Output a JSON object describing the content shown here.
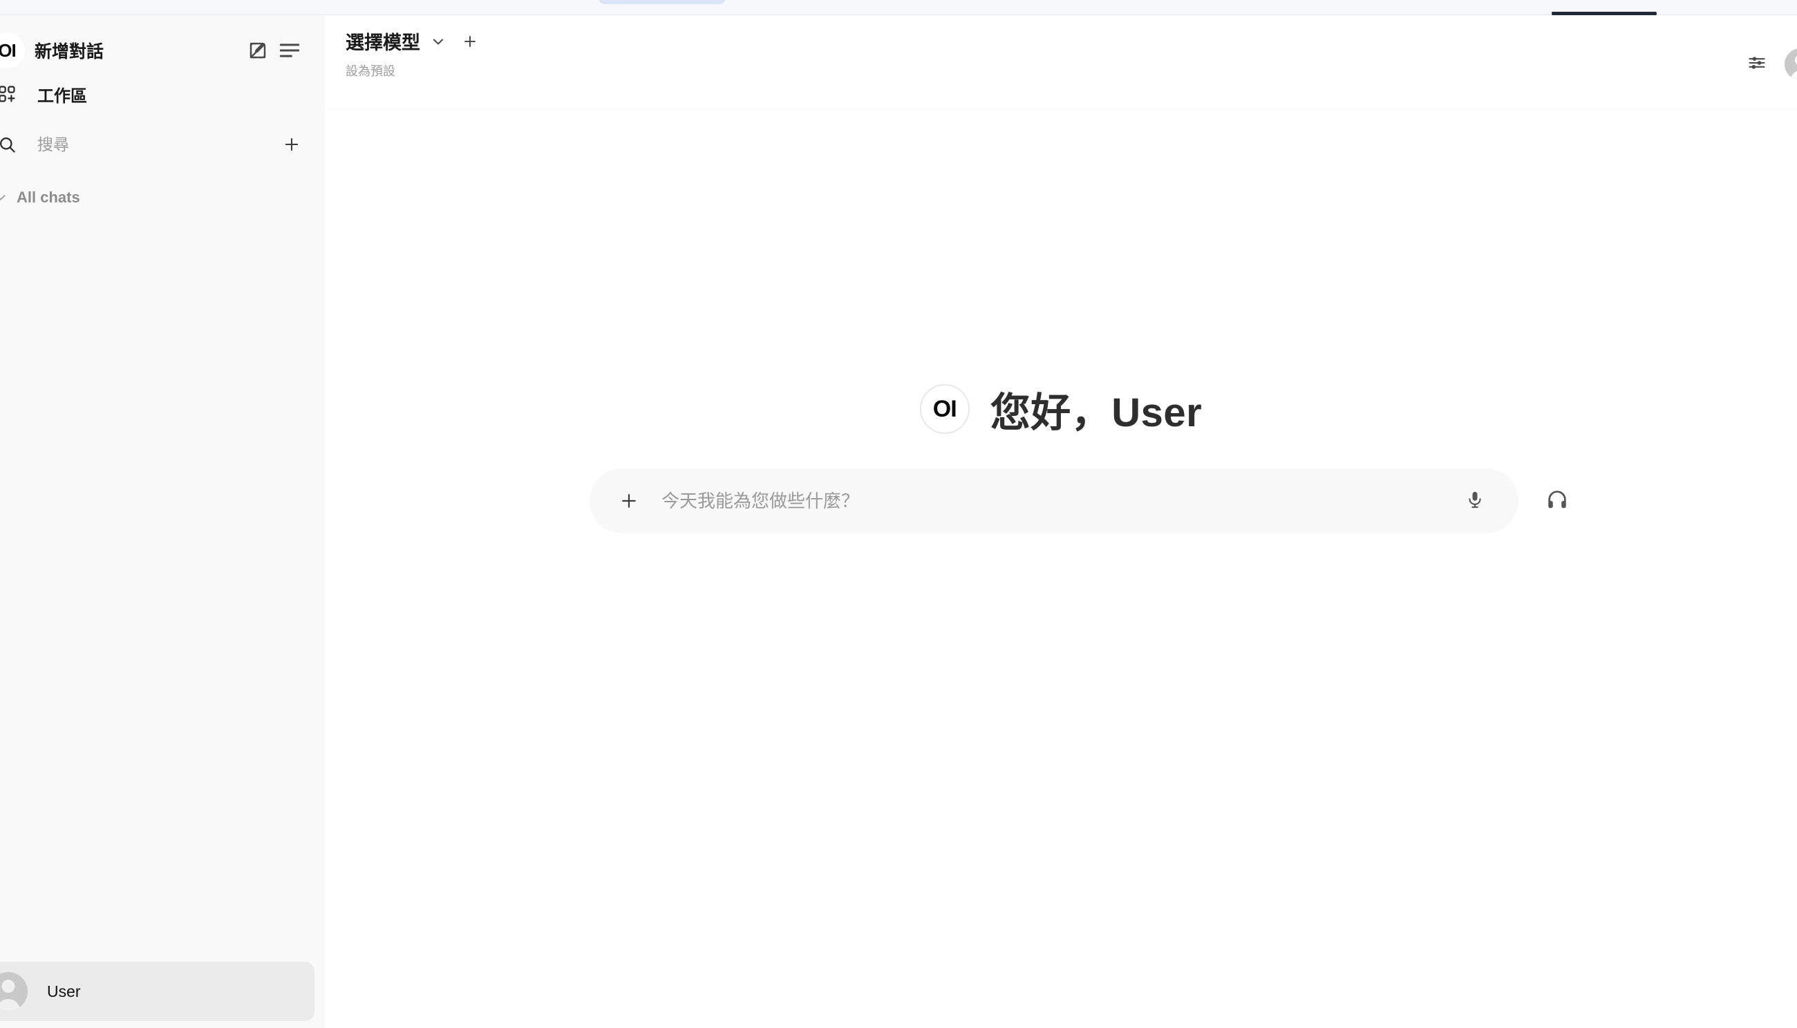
{
  "browser": {
    "tab_ghost": "",
    "active_tab_indicator": ""
  },
  "sidebar": {
    "logo_mark": "OI",
    "title": "新增對話",
    "new_chat_icon": "pencil-square-icon",
    "menu_icon": "list-lines-icon",
    "workspace": {
      "icon": "workspace-grid-plus-icon",
      "label": "工作區"
    },
    "search": {
      "icon": "search-icon",
      "placeholder": "搜尋",
      "value": "",
      "add_icon": "plus-icon"
    },
    "chat_group": {
      "chevron_icon": "chevron-down-icon",
      "label": "All chats"
    },
    "chats": [],
    "user": {
      "avatar_icon": "user-avatar-icon",
      "name": "User"
    }
  },
  "header": {
    "model_selector": {
      "label": "選擇模型",
      "chevron_icon": "chevron-down-icon",
      "add_icon": "plus-icon"
    },
    "set_default_label": "設為預設",
    "controls_icon": "sliders-icon",
    "avatar_icon": "user-avatar-icon"
  },
  "main": {
    "greeting": {
      "logo_mark": "OI",
      "text": "您好，User"
    },
    "composer": {
      "attach_icon": "plus-icon",
      "placeholder": "今天我能為您做些什麼？",
      "value": "",
      "mic_icon": "microphone-icon"
    },
    "call_icon": "headphones-icon"
  },
  "colors": {
    "sidebar_bg": "#f9f9f9",
    "main_bg": "#ffffff",
    "composer_bg": "#f8f8f8",
    "user_panel_bg": "#ebebeb",
    "text_primary": "#1a1a1a",
    "text_muted": "#9b9b9b",
    "chrome_tab": "#dbe5f7",
    "chrome_active": "#1f2937"
  }
}
